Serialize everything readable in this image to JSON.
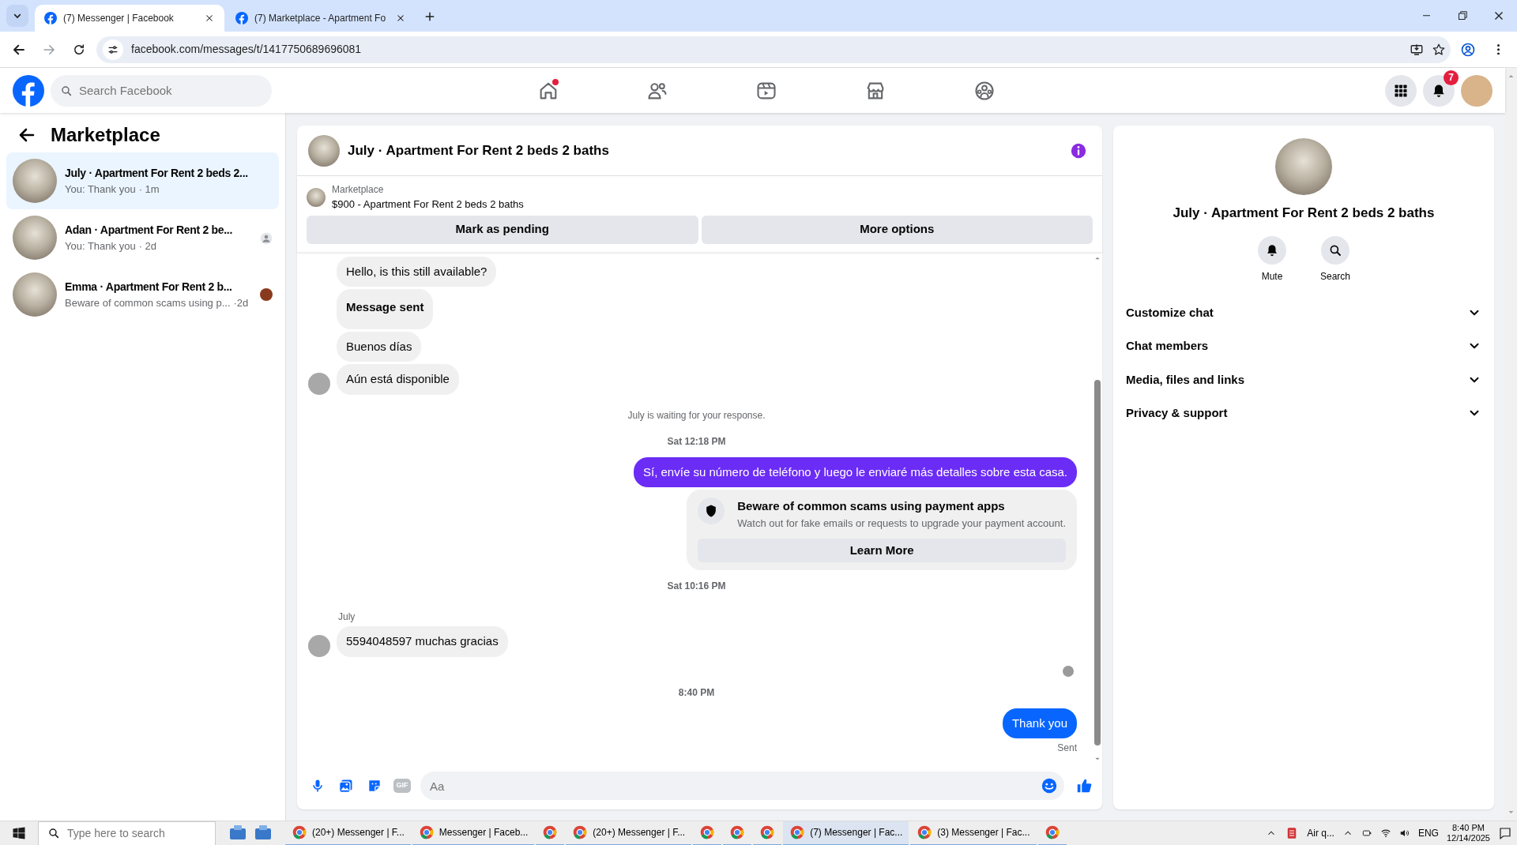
{
  "browser": {
    "tabs": [
      {
        "title": "(7) Messenger | Facebook",
        "selected": true
      },
      {
        "title": "(7) Marketplace - Apartment Fo",
        "selected": false
      }
    ],
    "url": "facebook.com/messages/t/1417750689696081"
  },
  "header": {
    "search_placeholder": "Search Facebook",
    "nav": [
      {
        "kind": "home",
        "has_notification": true
      },
      {
        "kind": "friends",
        "has_notification": false
      },
      {
        "kind": "video",
        "has_notification": false
      },
      {
        "kind": "marketplace",
        "has_notification": false
      },
      {
        "kind": "groups",
        "has_notification": false
      }
    ],
    "notification_count": "7"
  },
  "sidebar": {
    "title": "Marketplace",
    "conversations": [
      {
        "name": "July · Apartment For Rent 2 beds 2...",
        "preview": "You: Thank you",
        "time": "· 1m",
        "selected": true
      },
      {
        "name": "Adan · Apartment For Rent 2 be...",
        "preview": "You: Thank you",
        "time": "· 2d",
        "selected": false,
        "receipt": {
          "kind": "silhouette"
        }
      },
      {
        "name": "Emma · Apartment For Rent 2 b...",
        "preview": "Beware of common scams using p...",
        "time": "·2d",
        "selected": false,
        "receipt": {
          "kind": "photo"
        }
      }
    ]
  },
  "chat": {
    "title": "July · Apartment For Rent 2 beds 2 baths",
    "listing": {
      "source": "Marketplace",
      "title": "$900 - Apartment For Rent 2 beds 2 baths"
    },
    "actions": [
      "Mark as pending",
      "More options"
    ],
    "messages": [
      {
        "kind": "incoming",
        "text": "Hello, is this still available?",
        "bold": false,
        "avatar": false
      },
      {
        "kind": "incoming",
        "text": "Message sent",
        "bold": true,
        "avatar": false
      },
      {
        "kind": "incoming",
        "text": "Buenos días",
        "bold": false,
        "avatar": false
      },
      {
        "kind": "incoming",
        "text": "Aún está disponible",
        "bold": false,
        "avatar": true
      },
      {
        "kind": "status",
        "text": "July is waiting for your response."
      },
      {
        "kind": "time",
        "text": "Sat 12:18 PM"
      },
      {
        "kind": "outgoing",
        "text": "Sí, envíe su número de teléfono y luego le enviaré más detalles sobre esta casa.",
        "color": "#6b2cf5"
      },
      {
        "kind": "notice",
        "title": "Beware of common scams using payment apps",
        "text": "Watch out for fake emails or requests to upgrade your payment account.",
        "action": "Learn More"
      },
      {
        "kind": "time",
        "text": "Sat 10:16 PM"
      },
      {
        "kind": "sender",
        "text": "July"
      },
      {
        "kind": "incoming",
        "text": "5594048597 muchas gracias",
        "bold": false,
        "avatar": true
      },
      {
        "kind": "seen"
      },
      {
        "kind": "time",
        "text": "8:40 PM"
      },
      {
        "kind": "outgoing",
        "text": "Thank you",
        "color": "#0866ff"
      },
      {
        "kind": "delivery",
        "text": "Sent"
      }
    ],
    "composer": {
      "placeholder": "Aa",
      "gif_label": "GIF"
    }
  },
  "details": {
    "title": "July · Apartment For Rent 2 beds 2 baths",
    "actions": [
      {
        "kind": "mute",
        "label": "Mute"
      },
      {
        "kind": "search",
        "label": "Search"
      }
    ],
    "sections": [
      {
        "label": "Customize chat",
        "expanded": false
      },
      {
        "label": "Chat members",
        "expanded": false
      },
      {
        "label": "Media, files and links",
        "expanded": false
      },
      {
        "label": "Privacy & support",
        "expanded": false
      }
    ]
  },
  "taskbar": {
    "search_placeholder": "Type here to search",
    "apps": [
      {
        "label": "(20+) Messenger | F...",
        "selected": false
      },
      {
        "label": "Messenger | Faceb...",
        "selected": false
      },
      {
        "selected": false
      },
      {
        "label": "(20+) Messenger | F...",
        "selected": false
      },
      {
        "selected": false
      },
      {
        "selected": false
      },
      {
        "selected": false
      },
      {
        "label": "(7) Messenger | Fac...",
        "selected": true
      },
      {
        "label": "(3) Messenger | Fac...",
        "selected": false
      },
      {
        "selected": false
      }
    ],
    "weather": "Air q...",
    "language": "ENG",
    "time": "8:40 PM",
    "date": "12/14/2025"
  }
}
